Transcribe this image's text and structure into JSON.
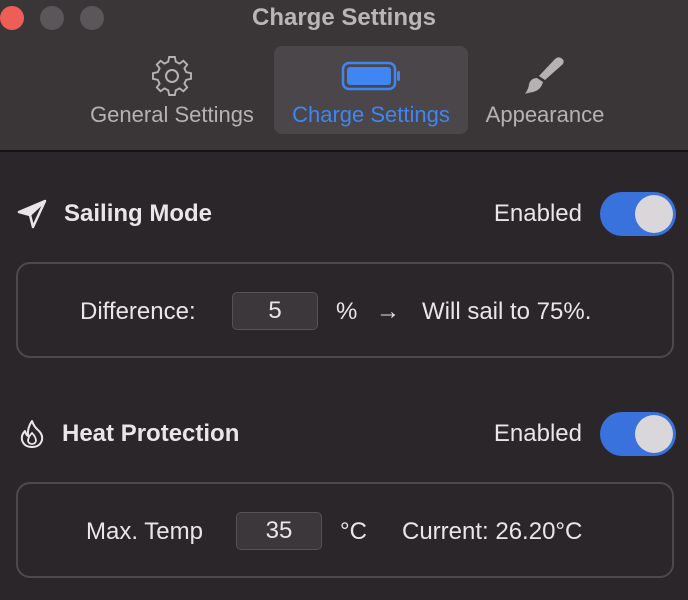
{
  "window": {
    "title": "Charge Settings"
  },
  "tabs": [
    {
      "label": "General Settings",
      "icon": "gear-icon",
      "selected": false
    },
    {
      "label": "Charge Settings",
      "icon": "battery-icon",
      "selected": true
    },
    {
      "label": "Appearance",
      "icon": "paintbrush-icon",
      "selected": false
    }
  ],
  "sailing": {
    "title": "Sailing Mode",
    "icon": "paper-plane-icon",
    "status": "Enabled",
    "enabled": true,
    "difference_label": "Difference:",
    "difference_value": "5",
    "unit": "%",
    "arrow": "→",
    "result_text": "Will sail to 75%."
  },
  "heat": {
    "title": "Heat Protection",
    "icon": "flame-icon",
    "status": "Enabled",
    "enabled": true,
    "max_temp_label": "Max. Temp",
    "max_temp_value": "35",
    "unit": "°C",
    "current_text": "Current: 26.20°C"
  },
  "colors": {
    "accent": "#3f86f2",
    "toggle_on": "#3a72dd",
    "close_button": "#ee5e56"
  }
}
